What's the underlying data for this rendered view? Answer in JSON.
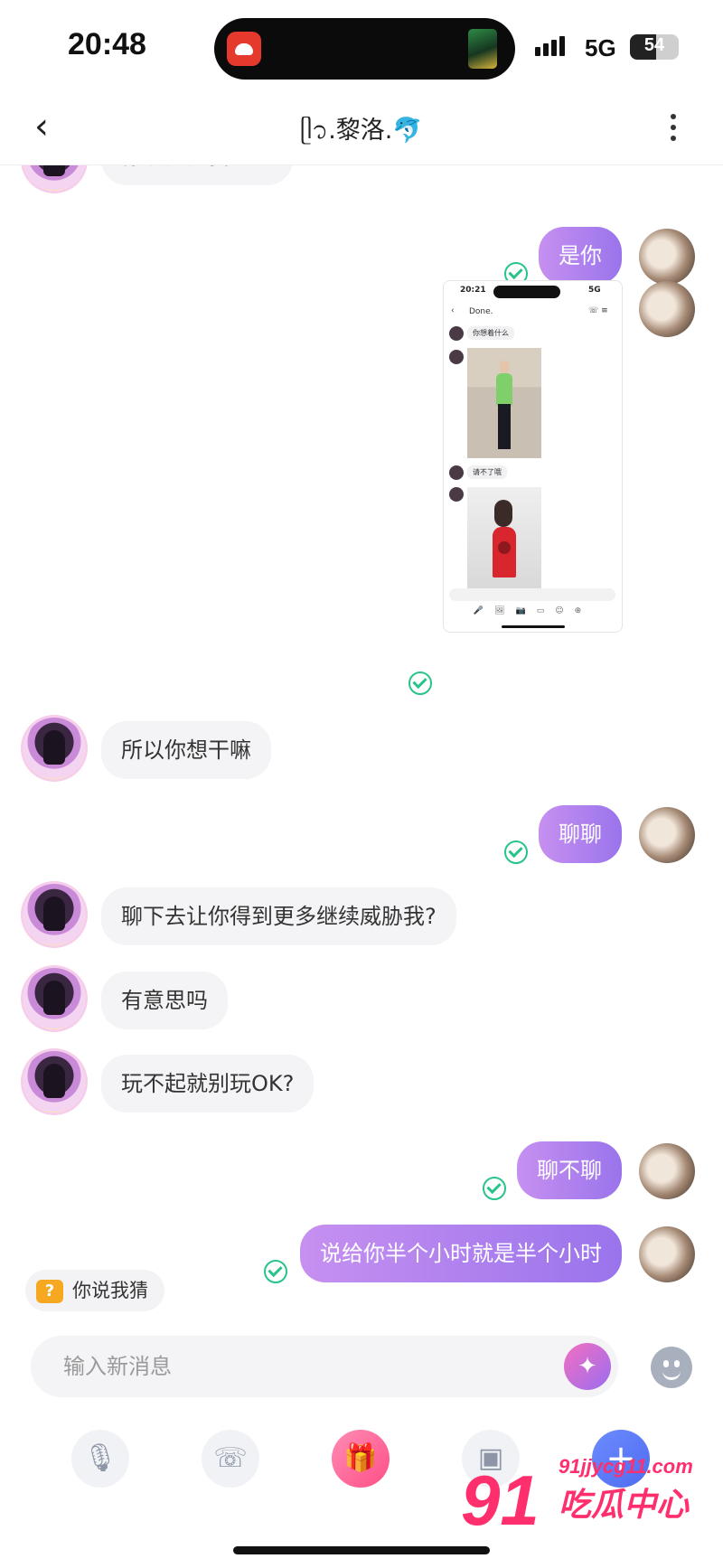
{
  "status_bar": {
    "time": "20:48",
    "network": "5G",
    "battery": "54",
    "battery_level": 0.54
  },
  "header": {
    "title": "ᥫ᭡.黎洛.🐬",
    "back_icon": "chevron-left-icon",
    "more_icon": "more-vertical-icon"
  },
  "messages": [
    {
      "side": "left",
      "text": "你确定是我？？"
    },
    {
      "side": "right",
      "text": "是你",
      "status": "sent"
    },
    {
      "side": "right",
      "type": "image",
      "status": "sent",
      "screenshot": {
        "time": "20:21",
        "network": "5G",
        "contact": "Done.",
        "bubble1": "你想着什么",
        "bubble2": "请不了哦"
      }
    },
    {
      "side": "left",
      "text": "所以你想干嘛"
    },
    {
      "side": "right",
      "text": "聊聊",
      "status": "sent"
    },
    {
      "side": "left",
      "text": "聊下去让你得到更多继续威胁我?"
    },
    {
      "side": "left",
      "text": "有意思吗"
    },
    {
      "side": "left",
      "text": "玩不起就别玩OK?"
    },
    {
      "side": "right",
      "text": "聊不聊",
      "status": "sent"
    },
    {
      "side": "right",
      "text": "说给你半个小时就是半个小时",
      "status": "sent"
    }
  ],
  "hint_chip": {
    "label": "你说我猜",
    "icon": "question-icon"
  },
  "composer": {
    "placeholder": "输入新消息",
    "magic_icon": "magic-wand-icon",
    "emoji_icon": "emoji-icon"
  },
  "toolbar": [
    "microphone-icon",
    "phone-icon",
    "gift-icon",
    "image-icon",
    "plus-icon"
  ],
  "watermark": {
    "number": "91",
    "url": "91jjycg11.com",
    "text": "吃瓜中心"
  },
  "colors": {
    "accent_start": "#c690f0",
    "accent_end": "#9a74ec",
    "check": "#29c48a",
    "watermark": "#ff2f6d"
  }
}
